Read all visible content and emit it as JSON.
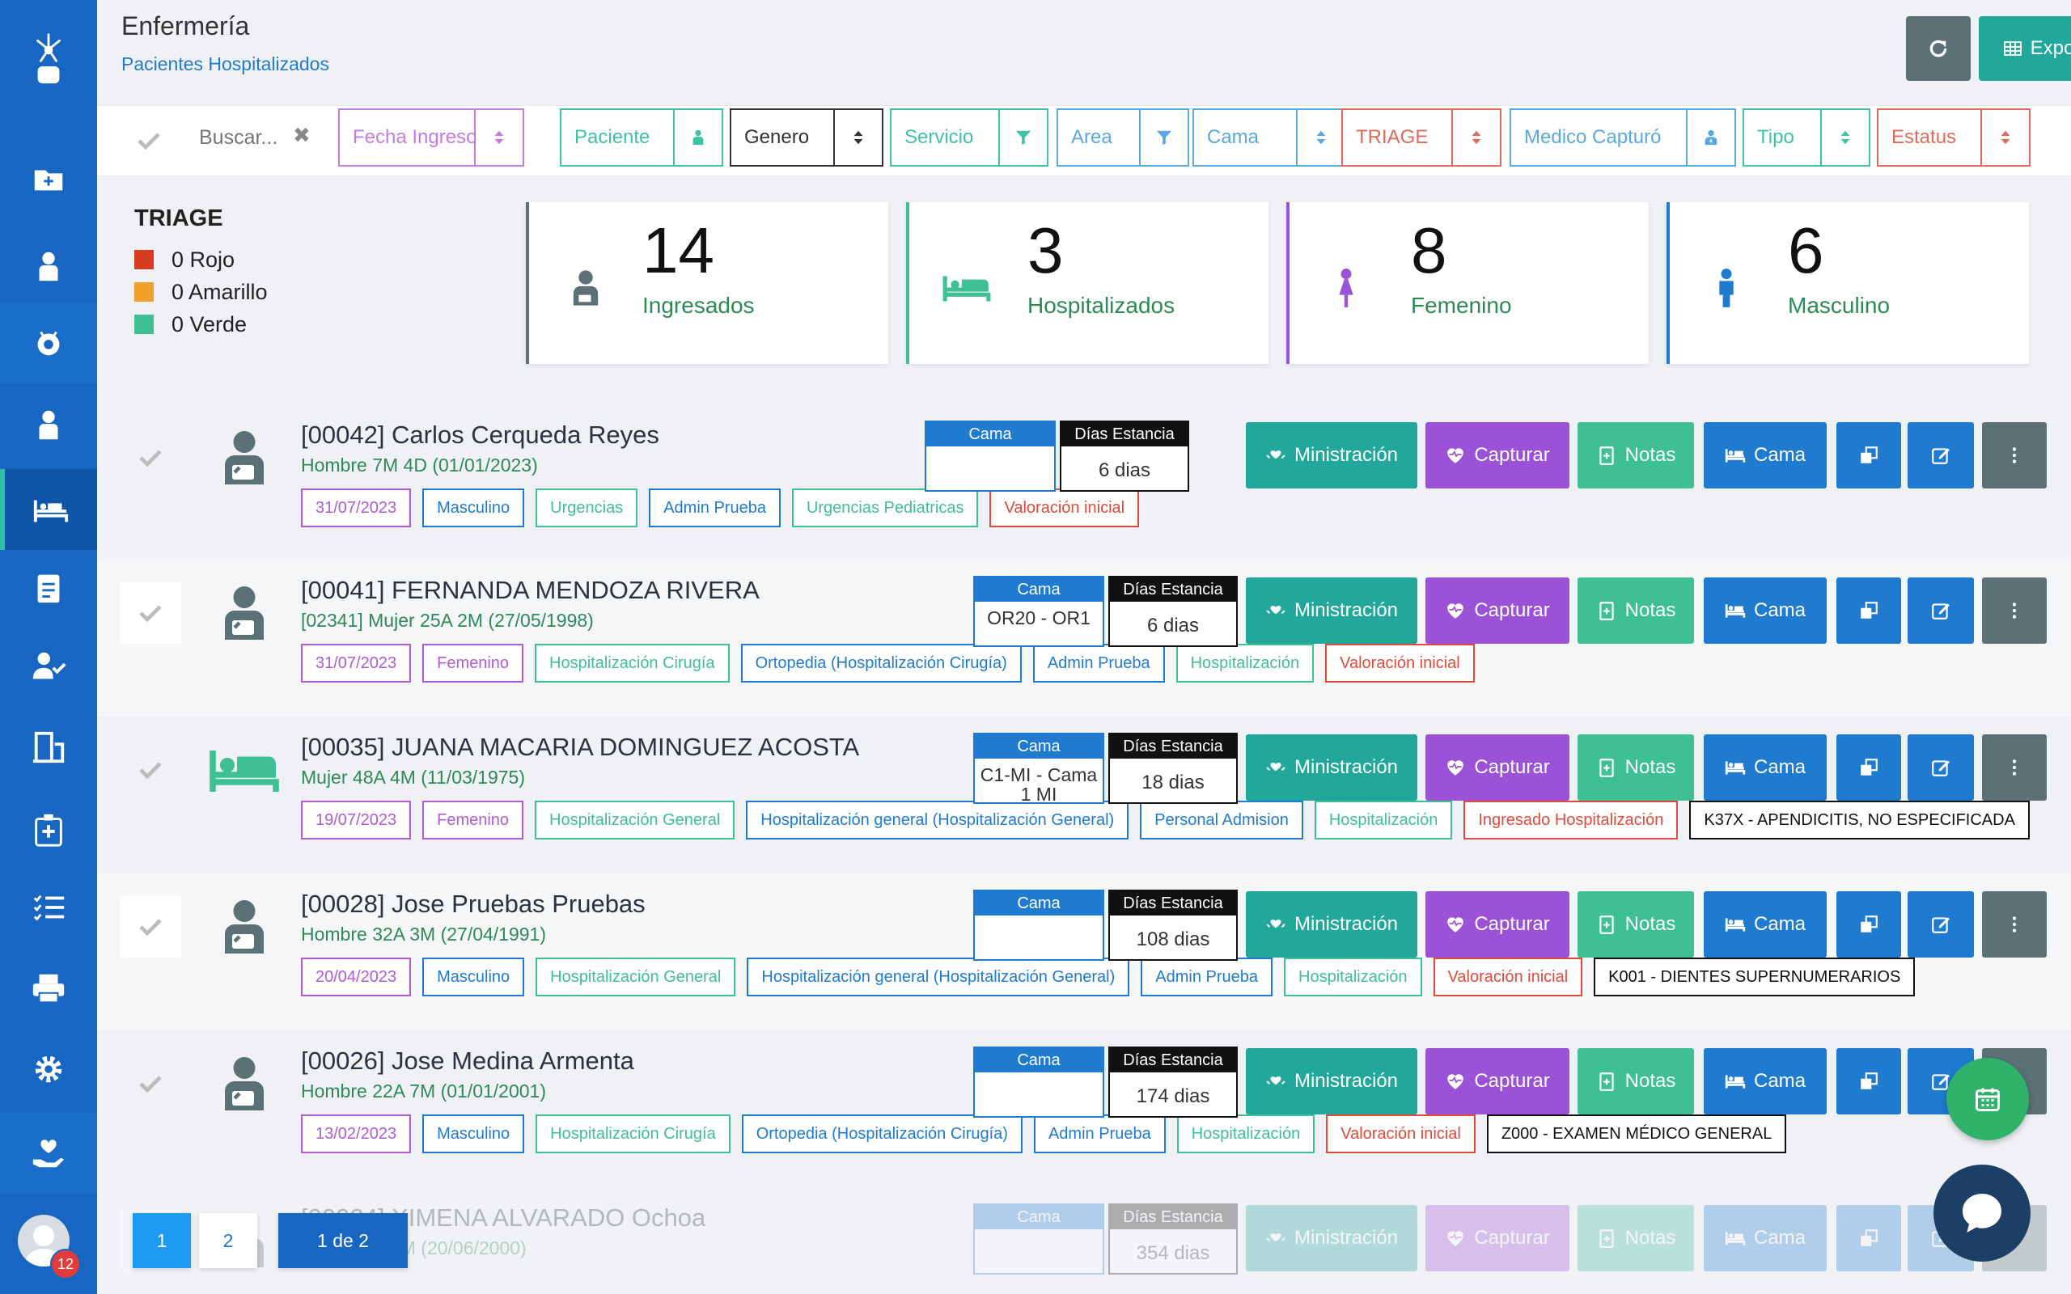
{
  "header": {
    "title": "Enfermería",
    "subtitle": "Pacientes Hospitalizados",
    "export_label": "Exportar",
    "refresh_icon": "refresh-icon",
    "export_icon": "table-icon"
  },
  "sidebar": {
    "logo_icon": "star-logo-icon",
    "items": [
      "inbox-icon",
      "folder-plus-icon",
      "user-injured-icon",
      "stethoscope-icon",
      "user-injured-icon",
      "procedures-bed-icon",
      "clipboard-list-icon",
      "user-check-icon",
      "hospital-door-icon",
      "medkit-icon",
      "tasks-icon",
      "print-icon",
      "gear-icon",
      "hand-holding-heart-icon"
    ],
    "active_item": "procedures-bed-icon",
    "notifications_badge": "12"
  },
  "filters": {
    "search_placeholder": "Buscar...",
    "clear_label": "✖",
    "items": [
      {
        "label": "Fecha Ingreso",
        "icon": "sort-icon",
        "color": "#c77ae0"
      },
      {
        "label": "Paciente",
        "icon": "user-injured-icon",
        "color": "#3fc2a6"
      },
      {
        "label": "Genero",
        "icon": "sort-icon",
        "color": "#333333"
      },
      {
        "label": "Servicio",
        "icon": "filter-icon",
        "color": "#3fc2a6"
      },
      {
        "label": "Area",
        "icon": "filter-icon",
        "color": "#5aa8e0"
      },
      {
        "label": "Cama",
        "icon": "sort-icon",
        "color": "#5aa8e0"
      },
      {
        "label": "TRIAGE",
        "icon": "sort-icon",
        "color": "#e06a5a"
      },
      {
        "label": "Medico Capturó",
        "icon": "user-md-icon",
        "color": "#5aa8e0"
      },
      {
        "label": "Tipo",
        "icon": "sort-icon",
        "color": "#3fc2a6"
      },
      {
        "label": "Estatus",
        "icon": "sort-icon",
        "color": "#e06a5a"
      }
    ]
  },
  "triage": {
    "title": "TRIAGE",
    "items": [
      {
        "label": "0 Rojo",
        "color": "#d83a1e"
      },
      {
        "label": "0 Amarillo",
        "color": "#f3a02b"
      },
      {
        "label": "0 Verde",
        "color": "#3fbf94"
      }
    ]
  },
  "stats": [
    {
      "value": "14",
      "label": "Ingresados",
      "color": "#2d8a56",
      "icon": "user-injured-icon"
    },
    {
      "value": "3",
      "label": "Hospitalizados",
      "color": "#2d8a56",
      "icon": "bed-icon"
    },
    {
      "value": "8",
      "label": "Femenino",
      "color": "#2d8a56",
      "icon": "female-icon"
    },
    {
      "value": "6",
      "label": "Masculino",
      "color": "#2d8a56",
      "icon": "male-icon"
    }
  ],
  "bed_header": "Cama",
  "days_header": "Días Estancia",
  "actions": {
    "ministracion": "Ministración",
    "capturar": "Capturar",
    "notas": "Notas",
    "cama": "Cama"
  },
  "patients": [
    {
      "name": "[00042] Carlos Cerqueda Reyes",
      "info": "Hombre 7M 4D (01/01/2023)",
      "bed": "",
      "days": "6 dias",
      "tags": [
        [
          "31/07/2023",
          "#b05ad6"
        ],
        [
          "Masculino",
          "#1e7bd0"
        ],
        [
          "Urgencias",
          "#3fbf94"
        ],
        [
          "Admin Prueba",
          "#1e7bd0"
        ],
        [
          "Urgencias Pediatricas",
          "#3fbf94"
        ],
        [
          "Valoración inicial",
          "#e04a3a"
        ]
      ]
    },
    {
      "name": "[00041] FERNANDA MENDOZA RIVERA",
      "info": "[02341] Mujer 25A 2M (27/05/1998)",
      "bed": "OR20 - OR1",
      "days": "6 dias",
      "tags": [
        [
          "31/07/2023",
          "#b05ad6"
        ],
        [
          "Femenino",
          "#b05ad6"
        ],
        [
          "Hospitalización Cirugía",
          "#3fbf94"
        ],
        [
          "Ortopedia (Hospitalización Cirugía)",
          "#1e7bd0"
        ],
        [
          "Admin Prueba",
          "#1e7bd0"
        ],
        [
          "Hospitalización",
          "#3fbf94"
        ],
        [
          "Valoración inicial",
          "#e04a3a"
        ]
      ]
    },
    {
      "name": "[00035] JUANA MACARIA DOMINGUEZ ACOSTA",
      "info": "Mujer 48A 4M (11/03/1975)",
      "bed": "C1-MI - Cama 1 MI",
      "days": "18 dias",
      "tags": [
        [
          "19/07/2023",
          "#b05ad6"
        ],
        [
          "Femenino",
          "#b05ad6"
        ],
        [
          "Hospitalización General",
          "#3fbf94"
        ],
        [
          "Hospitalización general (Hospitalización General)",
          "#1e7bd0"
        ],
        [
          "Personal Admision",
          "#1e7bd0"
        ],
        [
          "Hospitalización",
          "#3fbf94"
        ],
        [
          "Ingresado Hospitalización",
          "#e04a3a"
        ],
        [
          "K37X - APENDICITIS, NO ESPECIFICADA",
          "#111111"
        ]
      ]
    },
    {
      "name": "[00028] Jose Pruebas Pruebas",
      "info": "Hombre 32A 3M (27/04/1991)",
      "bed": "",
      "days": "108 dias",
      "tags": [
        [
          "20/04/2023",
          "#b05ad6"
        ],
        [
          "Masculino",
          "#1e7bd0"
        ],
        [
          "Hospitalización General",
          "#3fbf94"
        ],
        [
          "Hospitalización general (Hospitalización General)",
          "#1e7bd0"
        ],
        [
          "Admin Prueba",
          "#1e7bd0"
        ],
        [
          "Hospitalización",
          "#3fbf94"
        ],
        [
          "Valoración inicial",
          "#e04a3a"
        ],
        [
          "K001 - DIENTES SUPERNUMERARIOS",
          "#111111"
        ]
      ]
    },
    {
      "name": "[00026] Jose Medina Armenta",
      "info": "Hombre 22A 7M (01/01/2001)",
      "bed": "",
      "days": "174 dias",
      "tags": [
        [
          "13/02/2023",
          "#b05ad6"
        ],
        [
          "Masculino",
          "#1e7bd0"
        ],
        [
          "Hospitalización Cirugía",
          "#3fbf94"
        ],
        [
          "Ortopedia (Hospitalización Cirugía)",
          "#1e7bd0"
        ],
        [
          "Admin Prueba",
          "#1e7bd0"
        ],
        [
          "Hospitalización",
          "#3fbf94"
        ],
        [
          "Valoración inicial",
          "#e04a3a"
        ],
        [
          "Z000 - EXAMEN MÉDICO GENERAL",
          "#111111"
        ]
      ]
    },
    {
      "name": "[00024] XIMENA ALVARADO Ochoa",
      "info": "Mujer 23A 1M (20/06/2000)",
      "bed": "",
      "days": "354 dias",
      "tags": []
    }
  ],
  "pagination": {
    "page1": "1",
    "page2": "2",
    "status": "1 de 2"
  },
  "colors": {
    "sidebar": "#1666c2",
    "ministracion": "#21a89a",
    "capturar": "#9b52d6",
    "notas": "#3fbf94",
    "cama": "#1e7bd0",
    "action": "#1e7bd0",
    "more": "#5b7175"
  }
}
